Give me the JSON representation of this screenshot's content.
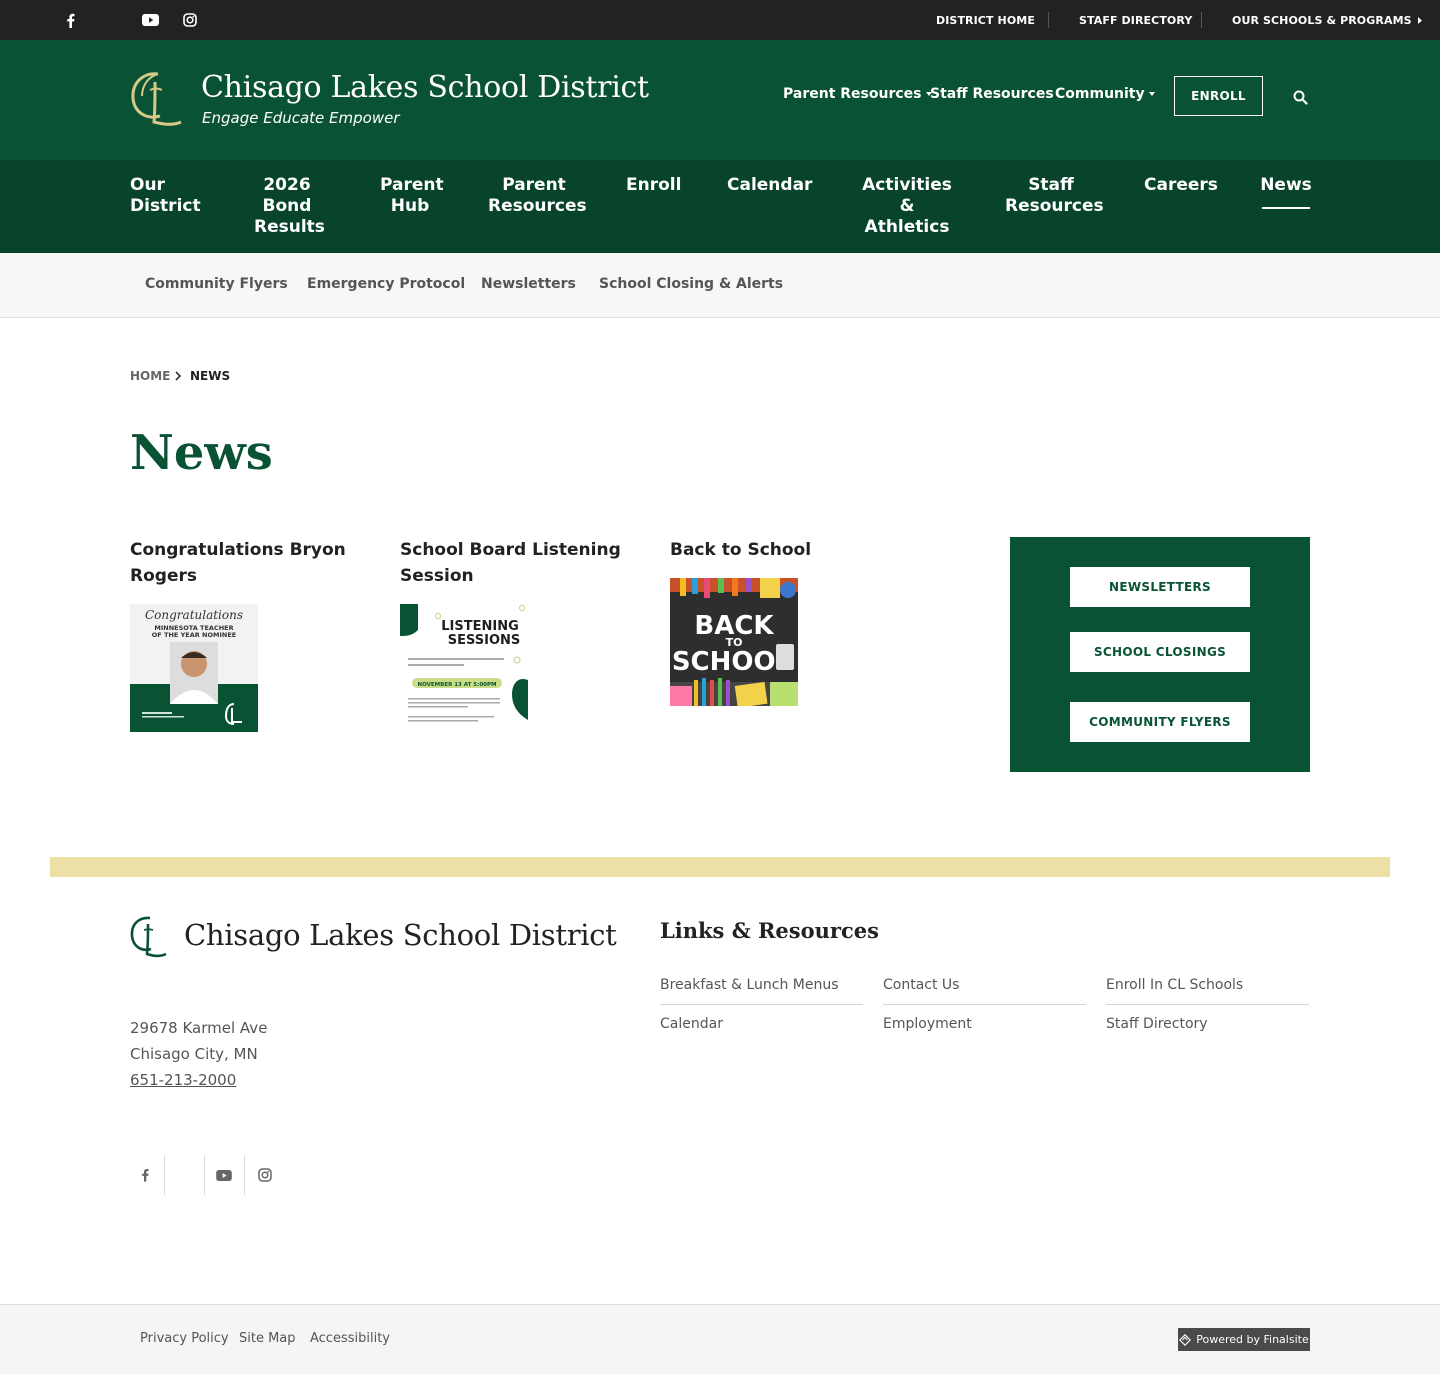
{
  "top_bar": {
    "social": [
      "facebook-icon",
      "youtube-icon",
      "instagram-icon"
    ],
    "links": [
      "DISTRICT HOME",
      "STAFF DIRECTORY",
      "OUR SCHOOLS & PROGRAMS"
    ]
  },
  "header": {
    "title": "Chisago Lakes School District",
    "tagline": "Engage Educate Empower",
    "links": [
      "Parent Resources",
      "Staff Resources",
      "Community"
    ],
    "enroll_label": "ENROLL",
    "search_icon": "search-icon"
  },
  "main_nav": {
    "items": [
      "Our District",
      "2026 Bond Results",
      "Parent Hub",
      "Parent Resources",
      "Enroll",
      "Calendar",
      "Activities & Athletics",
      "Staff Resources",
      "Careers",
      "News"
    ],
    "active": "News"
  },
  "sub_nav": {
    "items": [
      "Community Flyers",
      "Emergency Protocol",
      "Newsletters",
      "School Closing & Alerts"
    ]
  },
  "breadcrumb": {
    "home": "HOME",
    "current": "NEWS"
  },
  "page": {
    "title": "News"
  },
  "news": [
    {
      "title": "Congratulations Bryon Rogers",
      "thumb": {
        "script": "Congratulations",
        "line1": "MINNESOTA TEACHER",
        "line2": "OF THE YEAR NOMINEE"
      }
    },
    {
      "title": "School Board Listening Session",
      "thumb": {
        "line1": "LISTENING",
        "line2": "SESSIONS",
        "date": "NOVEMBER 13 AT 5:00PM"
      }
    },
    {
      "title": "Back to School",
      "thumb": {
        "line1": "BACK",
        "line2": "TO",
        "line3": "SCHOOL"
      }
    }
  ],
  "quick_links": [
    "NEWSLETTERS",
    "SCHOOL CLOSINGS",
    "COMMUNITY FLYERS"
  ],
  "footer": {
    "title": "Chisago Lakes School District",
    "address_line1": "29678 Karmel Ave",
    "address_line2": "Chisago City, MN",
    "phone": "651-213-2000",
    "links_heading": "Links & Resources",
    "links": [
      "Breakfast & Lunch Menus",
      "Contact Us",
      "Enroll In CL Schools",
      "Calendar",
      "Employment",
      "Staff Directory"
    ],
    "social": [
      "facebook-icon",
      "youtube-icon",
      "instagram-icon"
    ]
  },
  "bottom_bar": {
    "links": [
      "Privacy Policy",
      "Site Map",
      "Accessibility"
    ],
    "powered": "Powered by Finalsite"
  },
  "colors": {
    "brand_green": "#0a5234",
    "nav_green": "#07442b",
    "gold": "#ece0a6",
    "top_bar": "#222222"
  }
}
